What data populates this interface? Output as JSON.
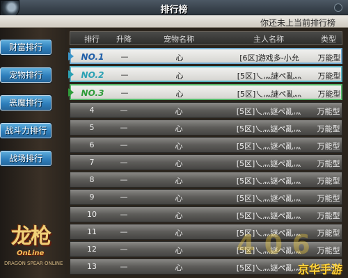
{
  "titlebar": {
    "title": "排行榜"
  },
  "subbar": {
    "notice": "你还未上当前排行榜"
  },
  "sidebar": {
    "items": [
      {
        "label": "财富排行"
      },
      {
        "label": "宠物排行"
      },
      {
        "label": "恶魔排行"
      },
      {
        "label": "战斗力排行"
      },
      {
        "label": "战场排行"
      }
    ]
  },
  "logo": {
    "title": "龙枪",
    "subtitle": "OnLine",
    "tagline": "DRAGON SPEAR ONLINE"
  },
  "table": {
    "headers": {
      "rank": "排行",
      "change": "升降",
      "pet": "宠物名称",
      "owner": "主人名称",
      "type": "类型"
    },
    "rows": [
      {
        "rank": "NO.1",
        "change": "—",
        "pet": "心",
        "owner": "[6区]游戏多-小允",
        "type": "万能型"
      },
      {
        "rank": "NO.2",
        "change": "—",
        "pet": "心",
        "owner": "[5区]乀灬謎ペ亂灬",
        "type": "万能型"
      },
      {
        "rank": "NO.3",
        "change": "—",
        "pet": "心",
        "owner": "[5区]乀灬謎ペ亂灬",
        "type": "万能型"
      },
      {
        "rank": "4",
        "change": "—",
        "pet": "心",
        "owner": "[5区]乀灬謎ペ亂灬",
        "type": "万能型"
      },
      {
        "rank": "5",
        "change": "—",
        "pet": "心",
        "owner": "[5区]乀灬謎ペ亂灬",
        "type": "万能型"
      },
      {
        "rank": "6",
        "change": "—",
        "pet": "心",
        "owner": "[5区]乀灬謎ペ亂灬",
        "type": "万能型"
      },
      {
        "rank": "7",
        "change": "—",
        "pet": "心",
        "owner": "[5区]乀灬謎ペ亂灬",
        "type": "万能型"
      },
      {
        "rank": "8",
        "change": "—",
        "pet": "心",
        "owner": "[5区]乀灬謎ペ亂灬",
        "type": "万能型"
      },
      {
        "rank": "9",
        "change": "—",
        "pet": "心",
        "owner": "[5区]乀灬謎ペ亂灬",
        "type": "万能型"
      },
      {
        "rank": "10",
        "change": "—",
        "pet": "心",
        "owner": "[5区]乀灬謎ペ亂灬",
        "type": "万能型"
      },
      {
        "rank": "11",
        "change": "—",
        "pet": "心",
        "owner": "[5区]乀灬謎ペ亂灬",
        "type": "万能型"
      },
      {
        "rank": "12",
        "change": "—",
        "pet": "心",
        "owner": "[5区]乀灬謎ペ亂灬",
        "type": "万能型"
      },
      {
        "rank": "13",
        "change": "—",
        "pet": "心",
        "owner": "[5区]乀灬謎ペ亂灬",
        "type": "万能型"
      }
    ]
  },
  "watermark": {
    "text": "京华手游",
    "big": "4 0 6"
  },
  "colors": {
    "button_blue": "#2f7fbc",
    "rank1": "#1f5ea8",
    "rank2": "#2aa1b4",
    "rank3": "#2f9c3a"
  }
}
